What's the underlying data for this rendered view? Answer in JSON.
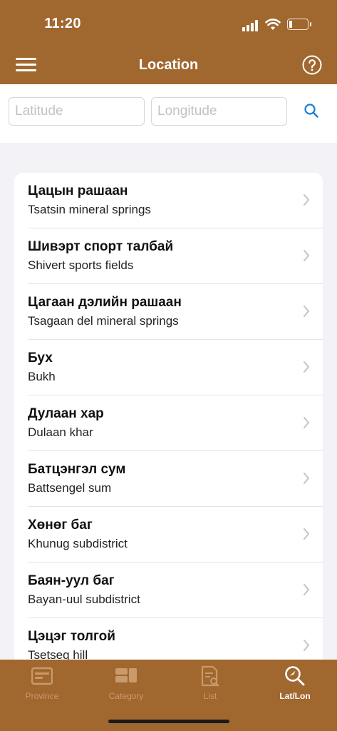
{
  "status_bar": {
    "time": "11:20"
  },
  "header": {
    "title": "Location"
  },
  "search": {
    "latitude_placeholder": "Latitude",
    "longitude_placeholder": "Longitude"
  },
  "locations": [
    {
      "title": "Цацын рашаан",
      "subtitle": "Tsatsin mineral springs"
    },
    {
      "title": "Шивэрт спорт талбай",
      "subtitle": "Shivert sports fields"
    },
    {
      "title": "Цагаан дэлийн рашаан",
      "subtitle": "Tsagaan del mineral springs"
    },
    {
      "title": "Бух",
      "subtitle": "Bukh"
    },
    {
      "title": "Дулаан хар",
      "subtitle": "Dulaan khar"
    },
    {
      "title": "Батцэнгэл сум",
      "subtitle": "Battsengel sum"
    },
    {
      "title": "Хөнөг баг",
      "subtitle": "Khunug subdistrict"
    },
    {
      "title": "Баян-уул баг",
      "subtitle": "Bayan-uul subdistrict"
    },
    {
      "title": "Цэцэг толгой",
      "subtitle": "Tsetseg hill"
    }
  ],
  "tabbar": {
    "tabs": [
      {
        "label": "Province",
        "icon": "province-icon",
        "active": false
      },
      {
        "label": "Category",
        "icon": "category-icon",
        "active": false
      },
      {
        "label": "List",
        "icon": "list-icon",
        "active": false
      },
      {
        "label": "Lat/Lon",
        "icon": "latlon-search-icon",
        "active": true
      }
    ]
  },
  "colors": {
    "brand": "#a0672f",
    "inactive_tab": "#c99a6a",
    "accent_blue": "#1e7ed6"
  }
}
